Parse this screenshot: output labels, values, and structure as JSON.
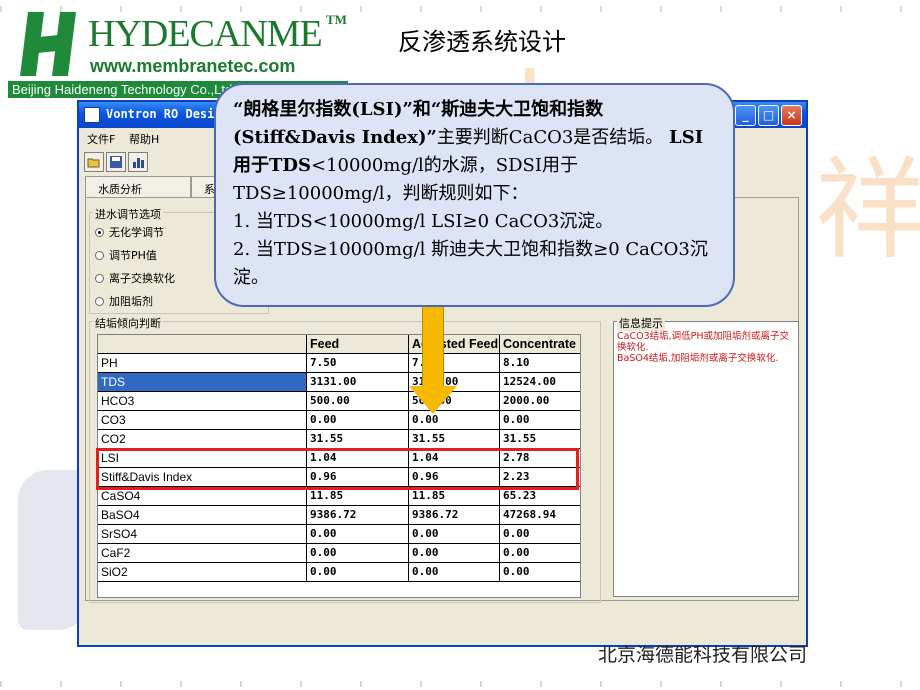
{
  "logo": {
    "brand": "HYDECANME",
    "tm": "TM",
    "url": "www.membranetec.com",
    "company_en": "Beijing Haideneng Technology Co.,Ltd"
  },
  "slide": {
    "title": "反渗透系统设计",
    "footer_company": "北京海德能科技有限公司"
  },
  "window": {
    "title": "Vontron RO Design",
    "menu": [
      "文件F",
      "帮助H"
    ],
    "tabs": [
      "水质分析",
      "系"
    ]
  },
  "inlet_group": {
    "label": "进水调节选项",
    "options": [
      {
        "label": "无化学调节",
        "checked": true
      },
      {
        "label": "调节PH值",
        "checked": false
      },
      {
        "label": "离子交换软化",
        "checked": false
      },
      {
        "label": "加阻垢剂",
        "checked": false
      }
    ]
  },
  "scaling": {
    "label": "结垢倾向判断",
    "columns": [
      "",
      "Feed",
      "Adjusted Feed",
      "Concentrate"
    ],
    "rows": [
      [
        "PH",
        "7.50",
        "7.50",
        "8.10"
      ],
      [
        "TDS",
        "3131.00",
        "3131.00",
        "12524.00"
      ],
      [
        "HCO3",
        "500.00",
        "500.00",
        "2000.00"
      ],
      [
        "CO3",
        "0.00",
        "0.00",
        "0.00"
      ],
      [
        "CO2",
        "31.55",
        "31.55",
        "31.55"
      ],
      [
        "LSI",
        "1.04",
        "1.04",
        "2.78"
      ],
      [
        "Stiff&Davis Index",
        "0.96",
        "0.96",
        "2.23"
      ],
      [
        "CaSO4",
        "11.85",
        "11.85",
        "65.23"
      ],
      [
        "BaSO4",
        "9386.72",
        "9386.72",
        "47268.94"
      ],
      [
        "SrSO4",
        "0.00",
        "0.00",
        "0.00"
      ],
      [
        "CaF2",
        "0.00",
        "0.00",
        "0.00"
      ],
      [
        "SiO2",
        "0.00",
        "0.00",
        "0.00"
      ]
    ]
  },
  "info": {
    "label": "信息提示",
    "lines": [
      "CaCO3结垢,调低PH或加阻垢剂或离子交换软化.",
      "BaSO4结垢,加阻垢剂或离子交换软化."
    ]
  },
  "callout": {
    "line1_bold": "“朗格里尔指数(LSI)”和“斯迪夫大卫饱和指数(Stiff&Davis Index)”",
    "line1_rest": "主要判断CaCO3是否结垢。",
    "line2_bold": "LSI用于TDS",
    "line2_rest": "<10000mg/l的水源，SDSI用于TDS≥10000mg/l，判断规则如下：",
    "rule1": "1. 当TDS<10000mg/l  LSI≥0  CaCO3沉淀。",
    "rule2": "2. 当TDS≥10000mg/l  斯迪夫大卫饱和指数≥0  CaCO3沉淀。"
  },
  "colors": {
    "highlight": "#e02020",
    "arrow": "#f7b800",
    "callout_bg": "#dde4f5",
    "titlebar": "#0856e3"
  }
}
